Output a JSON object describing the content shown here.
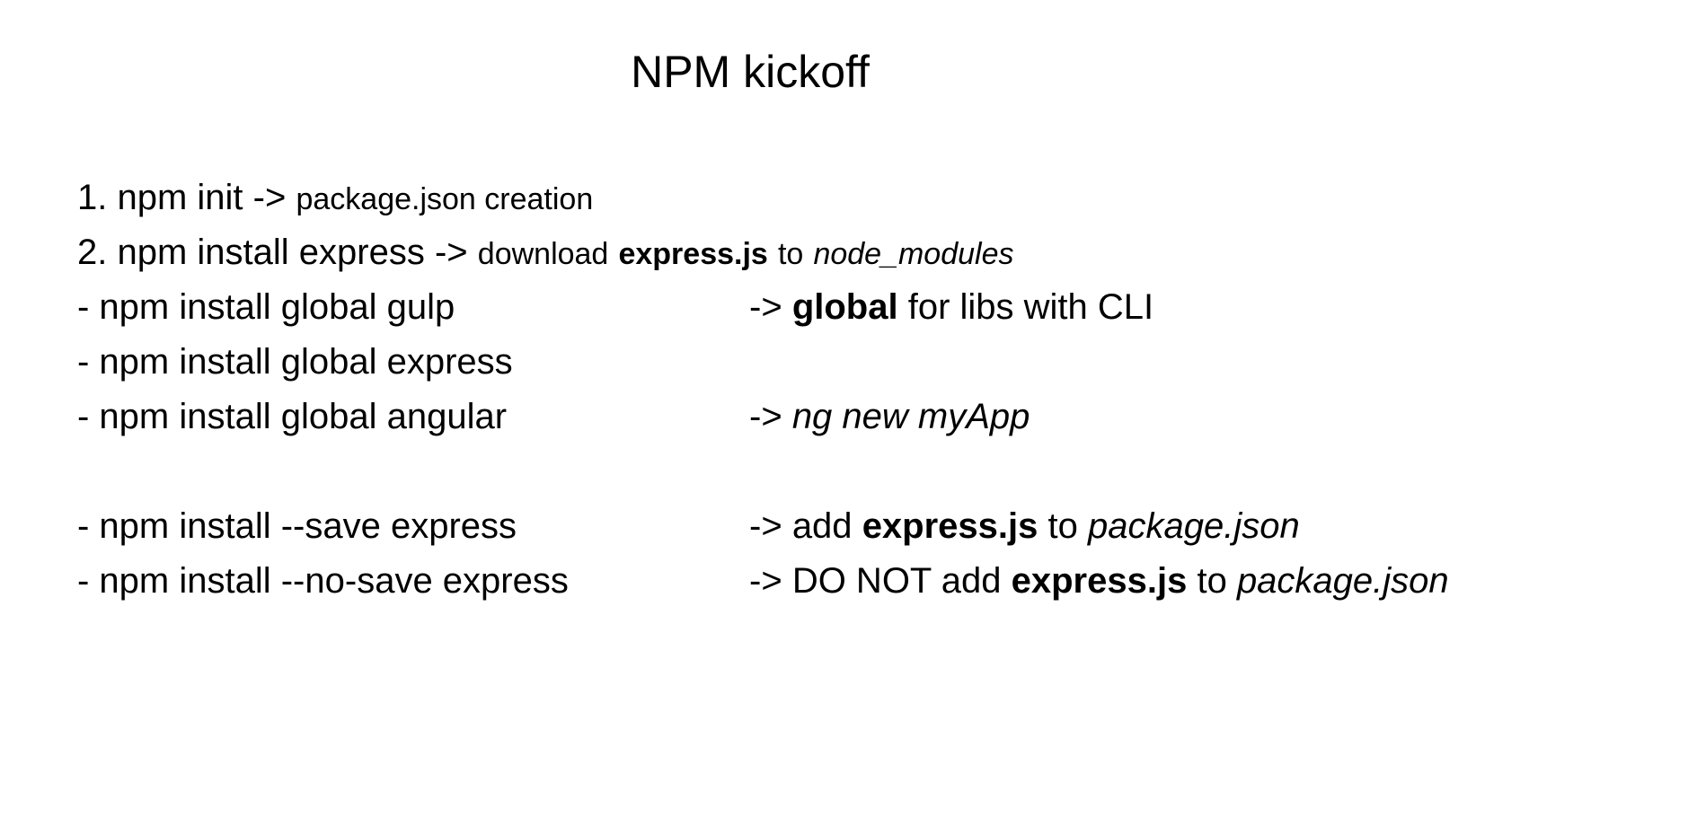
{
  "title": "NPM kickoff",
  "lines": {
    "l1": {
      "cmd": "1. npm init",
      "arrow": "->",
      "note": "package.json creation"
    },
    "l2": {
      "cmd": "2. npm install express",
      "arrow": "->",
      "note_pre": "download",
      "note_bold": "express.js",
      "note_mid": "to",
      "note_italic": "node_modules"
    },
    "l3": {
      "cmd": "- npm install global gulp",
      "arrow": "->",
      "note_bold": "global",
      "note_post": "for libs with CLI"
    },
    "l4": {
      "cmd": "- npm install global express"
    },
    "l5": {
      "cmd": "- npm install global angular",
      "arrow": "->",
      "note_italic": "ng new myApp"
    },
    "l6": {
      "cmd": "- npm install --save express",
      "arrow": "->",
      "note_pre": "add",
      "note_bold": "express.js",
      "note_mid": "to",
      "note_italic": "package.json"
    },
    "l7": {
      "cmd": "- npm install --no-save express",
      "arrow": "->",
      "note_pre": "DO NOT add",
      "note_bold": "express.js",
      "note_mid": "to",
      "note_italic": "package.json"
    }
  }
}
